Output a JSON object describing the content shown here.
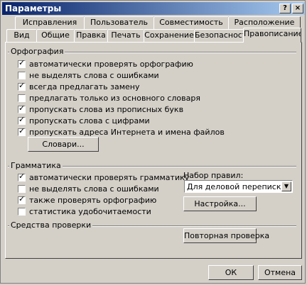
{
  "window": {
    "title": "Параметры",
    "help_label": "?",
    "close_label": "×"
  },
  "tabs": {
    "row1": [
      "Исправления",
      "Пользователь",
      "Совместимость",
      "Расположение"
    ],
    "row2": [
      "Вид",
      "Общие",
      "Правка",
      "Печать",
      "Сохранение",
      "Безопасность",
      "Правописание"
    ],
    "active": "Правописание"
  },
  "spelling": {
    "title": "Орфография",
    "options": [
      {
        "label": "автоматически проверять орфографию",
        "checked": true
      },
      {
        "label": "не выделять слова с ошибками",
        "checked": false
      },
      {
        "label": "всегда предлагать замену",
        "checked": true
      },
      {
        "label": "предлагать только из основного словаря",
        "checked": false
      },
      {
        "label": "пропускать слова из прописных букв",
        "checked": true
      },
      {
        "label": "пропускать слова с цифрами",
        "checked": true
      },
      {
        "label": "пропускать адреса Интернета и имена файлов",
        "checked": true
      }
    ],
    "dictionaries_button": "Словари..."
  },
  "grammar": {
    "title": "Грамматика",
    "options": [
      {
        "label": "автоматически проверять грамматику",
        "checked": true
      },
      {
        "label": "не выделять слова с ошибками",
        "checked": false
      },
      {
        "label": "также проверять орфографию",
        "checked": true
      },
      {
        "label": "статистика удобочитаемости",
        "checked": false
      }
    ],
    "rules_label": "Набор правил:",
    "rules_value": "Для деловой переписки",
    "settings_button": "Настройка..."
  },
  "proofing": {
    "title": "Средства проверки",
    "recheck_button": "Повторная проверка"
  },
  "footer": {
    "ok": "ОК",
    "cancel": "Отмена"
  }
}
